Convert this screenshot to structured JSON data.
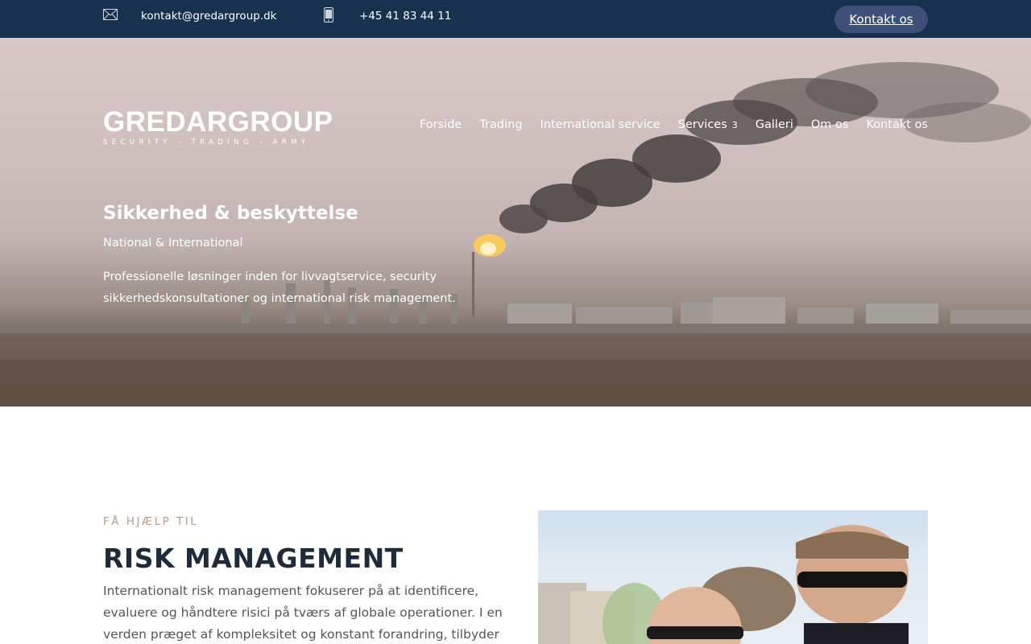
{
  "topbar": {
    "email": "kontakt@gredargroup.dk",
    "phone": "+45 41 83 44 11",
    "cta_label": "Kontakt os",
    "mail_icon": "envelope-icon",
    "phone_icon": "mobile-phone-icon",
    "background_color": "#17314f",
    "cta_color": "#3e4f7a"
  },
  "brand": {
    "name": "GREDARGROUP",
    "tagline": "SECURITY - TRADING - ARMY"
  },
  "nav": {
    "items": [
      {
        "label": "Forside"
      },
      {
        "label": "Trading"
      },
      {
        "label": "International service"
      },
      {
        "label": "Services",
        "has_dropdown": true,
        "chevron": "3"
      },
      {
        "label": "Galleri"
      },
      {
        "label": "Om os"
      },
      {
        "label": "Kontakt os"
      }
    ]
  },
  "hero": {
    "title": "Sikkerhed & beskyttelse",
    "subtitle": "National & International",
    "text": "Professionelle løsninger inden for livvagtservice, security sikkerhedskonsultationer og international risk management."
  },
  "section": {
    "kicker": "FÅ HJÆLP TIL",
    "title": "RISK MANAGEMENT",
    "body": "Internationalt risk management fokuserer på at identificere, evaluere og håndtere risici på tværs af globale operationer. I en verden præget af kompleksitet og konstant forandring, tilbyder vi",
    "kicker_color": "#b89c84",
    "title_color": "#1d2b3a"
  }
}
